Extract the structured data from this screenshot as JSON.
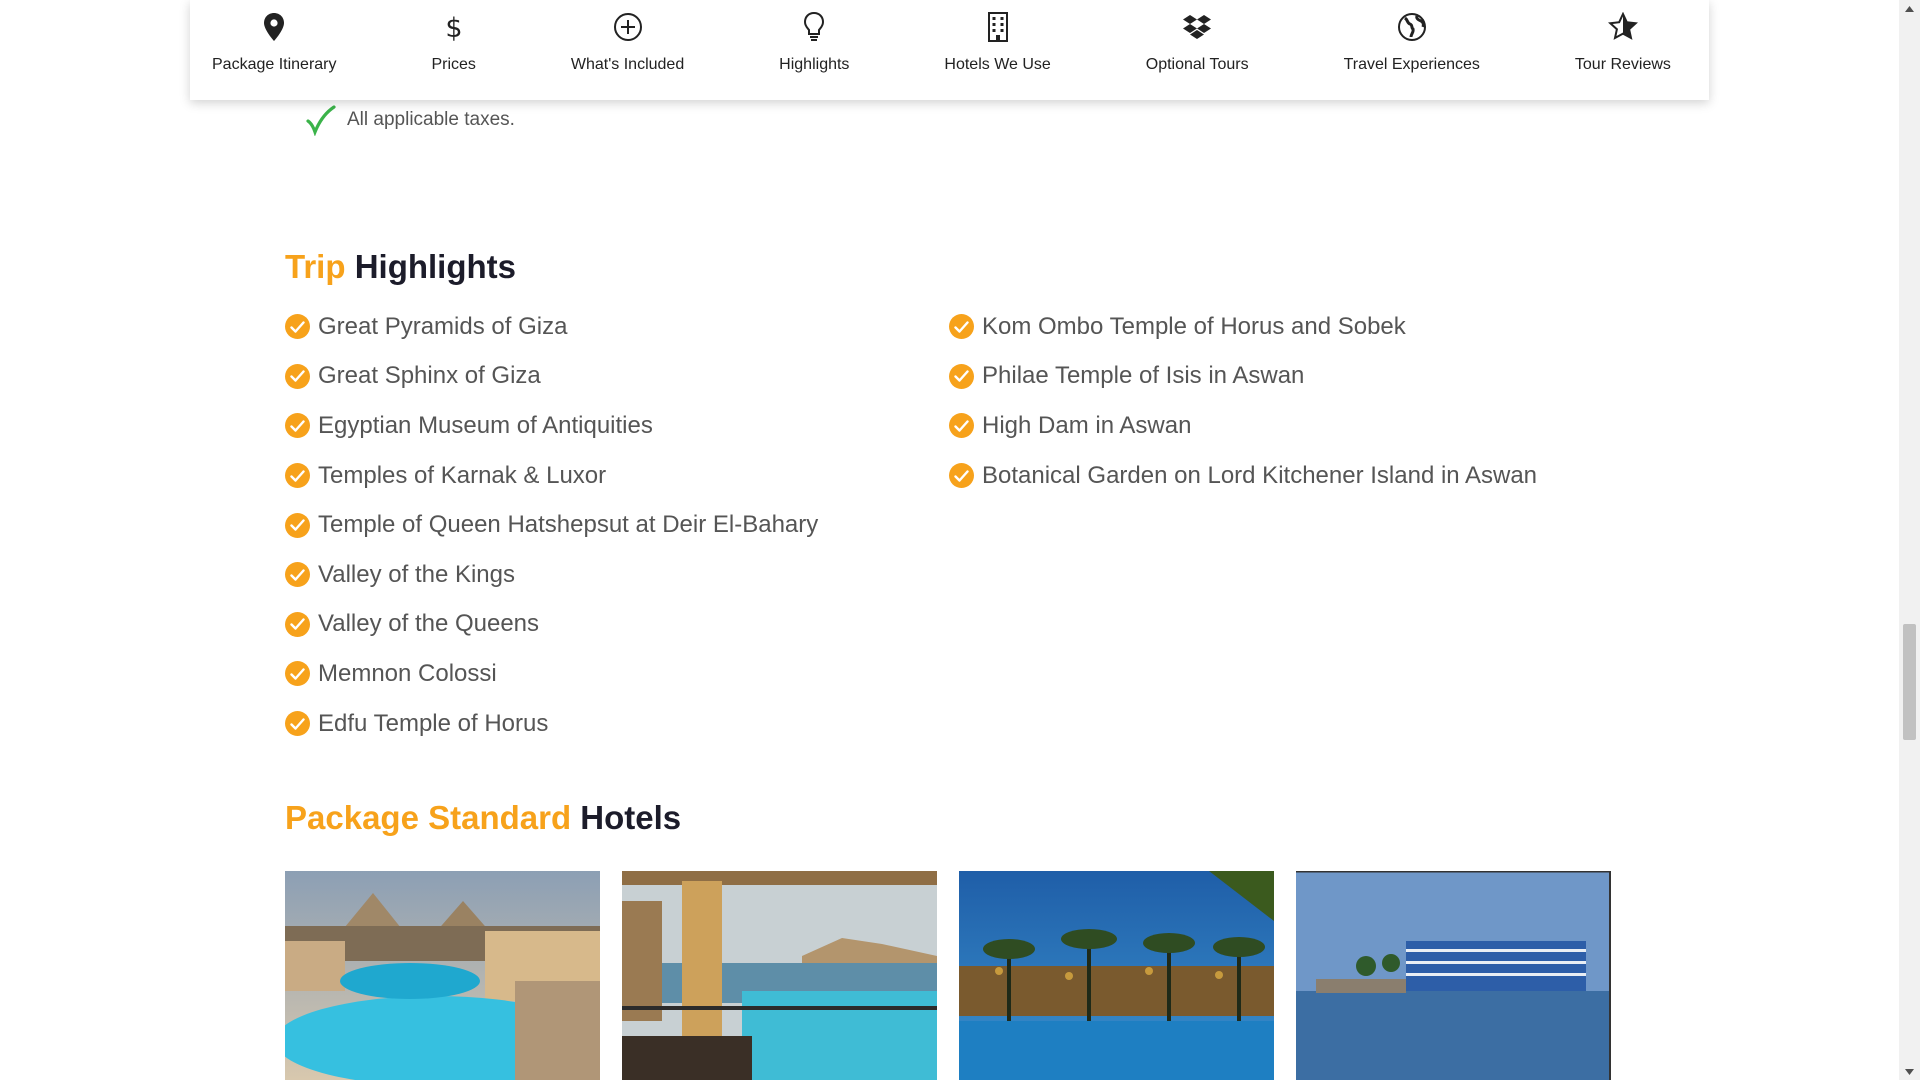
{
  "nav": {
    "tabs": [
      {
        "label": "Package Itinerary",
        "icon": "map-pin-icon"
      },
      {
        "label": "Prices",
        "icon": "dollar-icon"
      },
      {
        "label": "What's Included",
        "icon": "plus-circle-icon"
      },
      {
        "label": "Highlights",
        "icon": "lightbulb-icon"
      },
      {
        "label": "Hotels We Use",
        "icon": "building-icon"
      },
      {
        "label": "Optional Tours",
        "icon": "dropbox-icon"
      },
      {
        "label": "Travel Experiences",
        "icon": "globe-icon"
      },
      {
        "label": "Tour Reviews",
        "icon": "star-icon"
      }
    ]
  },
  "included": {
    "last_item": "All applicable taxes."
  },
  "highlights": {
    "title_accent": "Trip",
    "title_main": "Highlights",
    "left": [
      "Great Pyramids of Giza",
      "Great Sphinx of Giza",
      "Egyptian Museum of Antiquities",
      "Temples of Karnak & Luxor",
      "Temple of Queen Hatshepsut at Deir El-Bahary",
      "Valley of the Kings",
      "Valley of the Queens",
      "Memnon Colossi",
      "Edfu Temple of Horus"
    ],
    "right": [
      "Kom Ombo Temple of Horus and Sobek",
      "Philae Temple of Isis in Aswan",
      "High Dam in Aswan",
      "Botanical Garden on Lord Kitchener Island in Aswan"
    ]
  },
  "hotels": {
    "title_accent": "Package Standard",
    "title_main": "Hotels"
  },
  "colors": {
    "accent": "#f7a21b",
    "heading": "#1c1c2a",
    "body_text": "#555555",
    "check_green": "#3bb34a"
  }
}
